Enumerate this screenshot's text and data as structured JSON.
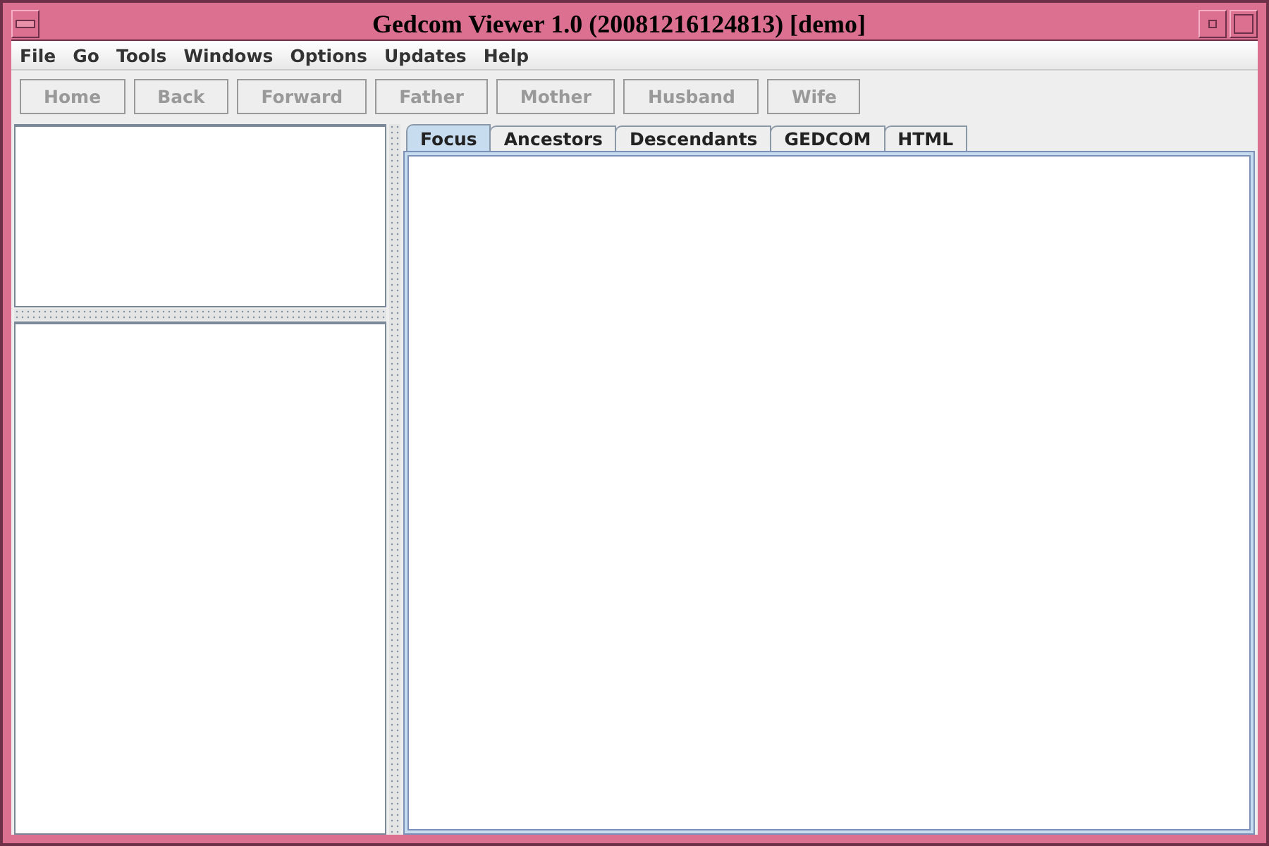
{
  "window": {
    "title": "Gedcom Viewer 1.0 (20081216124813) [demo]"
  },
  "menu": [
    "File",
    "Go",
    "Tools",
    "Windows",
    "Options",
    "Updates",
    "Help"
  ],
  "toolbar": [
    {
      "label": "Home",
      "disabled": true
    },
    {
      "label": "Back",
      "disabled": true
    },
    {
      "label": "Forward",
      "disabled": true
    },
    {
      "label": "Father",
      "disabled": true
    },
    {
      "label": "Mother",
      "disabled": true
    },
    {
      "label": "Husband",
      "disabled": true
    },
    {
      "label": "Wife",
      "disabled": true
    }
  ],
  "tabs": [
    {
      "label": "Focus",
      "selected": true
    },
    {
      "label": "Ancestors",
      "selected": false
    },
    {
      "label": "Descendants",
      "selected": false
    },
    {
      "label": "GEDCOM",
      "selected": false
    },
    {
      "label": "HTML",
      "selected": false
    }
  ]
}
